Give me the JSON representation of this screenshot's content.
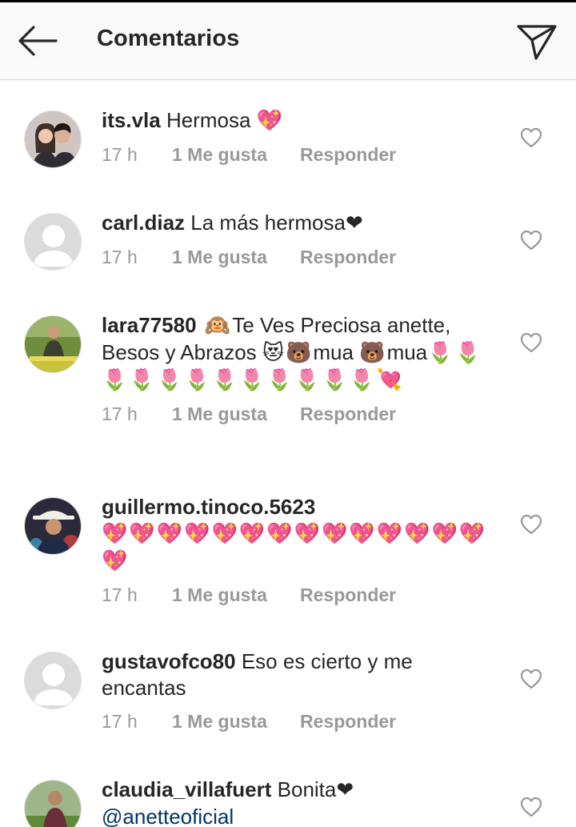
{
  "header": {
    "title": "Comentarios"
  },
  "comments": [
    {
      "username": "its.vla",
      "text": " Hermosa ",
      "emoji": "💖",
      "time": "17 h",
      "likes": "1 Me gusta",
      "reply": "Responder"
    },
    {
      "username": "carl.diaz",
      "text": " La más hermosa",
      "emoji": "❤",
      "time": "17 h",
      "likes": "1 Me gusta",
      "reply": "Responder"
    },
    {
      "username": "lara77580",
      "emoji_lead": " 🙉",
      "text": "Te Ves Preciosa anette, Besos y Abrazos ",
      "emoji_mid": "😻🐻",
      "text2": "mua ",
      "emoji_mid2": "🐻",
      "text3": "mua",
      "emoji_tail": "🌷🌷🌷🌷🌷🌷🌷🌷🌷🌷🌷🌷💘",
      "time": "17 h",
      "likes": "1 Me gusta",
      "reply": "Responder"
    },
    {
      "username": "guillermo.tinoco.5623",
      "emoji": "💖💖💖💖💖💖💖💖💖💖💖💖💖💖💖",
      "time": "17 h",
      "likes": "1 Me gusta",
      "reply": "Responder"
    },
    {
      "username": "gustavofco80",
      "text": " Eso es cierto y me encantas",
      "time": "17 h",
      "likes": "1 Me gusta",
      "reply": "Responder"
    },
    {
      "username": "claudia_villafuert",
      "text": " Bonita",
      "emoji": "❤",
      "mention": "@anetteoficial"
    }
  ],
  "icons": {
    "back": "arrow-left-icon",
    "send": "paper-plane-icon",
    "like": "heart-outline-icon"
  },
  "colors": {
    "text": "#262626",
    "meta": "#999999",
    "mention": "#003569",
    "header_bg": "#f9f9f9"
  }
}
